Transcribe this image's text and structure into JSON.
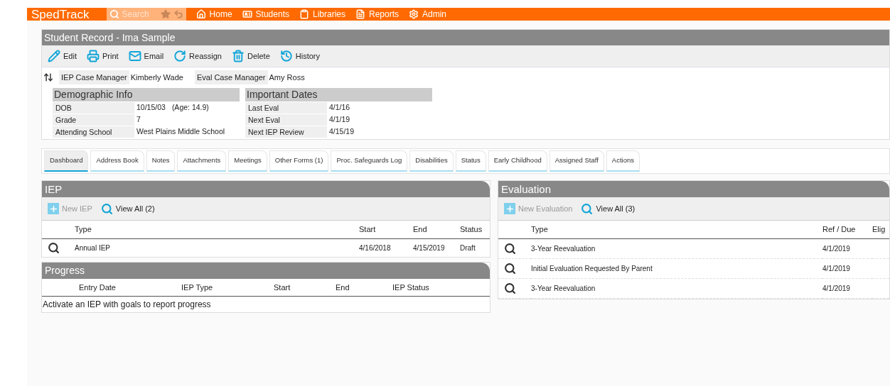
{
  "topbar": {
    "logo": "SpedTrack",
    "search": {
      "placeholder": "Search"
    },
    "nav": [
      {
        "label": "Home"
      },
      {
        "label": "Students"
      },
      {
        "label": "Libraries"
      },
      {
        "label": "Reports"
      },
      {
        "label": "Admin"
      }
    ]
  },
  "record": {
    "title": "Student Record - Ima Sample",
    "toolbar": [
      {
        "label": "Edit"
      },
      {
        "label": "Print"
      },
      {
        "label": "Email"
      },
      {
        "label": "Reassign"
      },
      {
        "label": "Delete"
      },
      {
        "label": "History"
      }
    ],
    "managers": [
      {
        "label": "IEP Case Manager",
        "value": "Kimberly Wade"
      },
      {
        "label": "Eval Case Manager",
        "value": "Amy Ross"
      }
    ],
    "sections": [
      {
        "title": "Demographic Info",
        "rows": [
          [
            "DOB",
            "10/15/03",
            "(Age: 14.9)"
          ],
          [
            "Grade",
            "7"
          ],
          [
            "Attending School",
            "West Plains Middle School"
          ]
        ]
      },
      {
        "title": "Important Dates",
        "rows": [
          [
            "Last Eval",
            "4/1/16"
          ],
          [
            "Next Eval",
            "4/1/19"
          ],
          [
            "Next IEP Review",
            "4/15/19"
          ]
        ]
      }
    ]
  },
  "tabs": [
    {
      "label": "Dashboard",
      "selected": true
    },
    {
      "label": "Address Book",
      "selected": false
    },
    {
      "label": "Notes",
      "selected": false
    },
    {
      "label": "Attachments",
      "selected": false
    },
    {
      "label": "Meetings",
      "selected": false
    },
    {
      "label": "Other Forms (1)",
      "selected": false
    },
    {
      "label": "Proc. Safeguards Log",
      "selected": false
    },
    {
      "label": "Disabilities",
      "selected": false
    },
    {
      "label": "Status",
      "selected": false
    },
    {
      "label": "Early Childhood",
      "selected": false
    },
    {
      "label": "Assigned Staff",
      "selected": false
    },
    {
      "label": "Actions",
      "selected": false
    }
  ],
  "iep": {
    "title": "IEP",
    "new_label": "New IEP",
    "new_disabled": true,
    "view_all": "View All (2)",
    "columns": [
      "Type",
      "Start",
      "End",
      "Status"
    ],
    "rows": [
      [
        "Annual IEP",
        "4/16/2018",
        "4/15/2019",
        "Draft"
      ]
    ]
  },
  "progress": {
    "title": "Progress",
    "columns": [
      "Entry Date",
      "IEP Type",
      "Start",
      "End",
      "IEP Status"
    ],
    "empty": "Activate an IEP with goals to report progress"
  },
  "evaluation": {
    "title": "Evaluation",
    "new_label": "New Evaluation",
    "new_disabled": true,
    "view_all": "View All (3)",
    "columns": [
      "Type",
      "Ref / Due",
      "Elig"
    ],
    "rows": [
      [
        "3-Year Reevaluation",
        "4/1/2019"
      ],
      [
        "Initial Evaluation Requested By Parent",
        "4/1/2019"
      ],
      [
        "3-Year Reevaluation",
        "4/1/2019"
      ]
    ]
  }
}
